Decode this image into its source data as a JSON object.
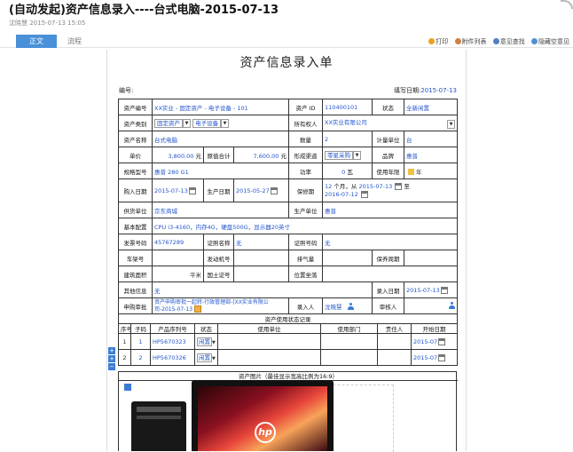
{
  "header": {
    "title": "(自动发起)资产信息录入----台式电脑-2015-07-13",
    "meta": "沈晓慧 2015-07-13 15:05"
  },
  "tabs": [
    {
      "label": "正文",
      "active": true
    },
    {
      "label": "流程",
      "active": false
    }
  ],
  "toolbar": {
    "print": "打印",
    "attachments": "附件列表",
    "find_opinion": "意见查找",
    "hide_opinion": "隐藏空意见"
  },
  "doc": {
    "title": "资产信息录入单",
    "number_label": "编号:",
    "number_value": "",
    "fill_date_label": "填写日期:",
    "fill_date_value": "2015-07-13"
  },
  "form": {
    "asset_code_label": "资产编号",
    "asset_code": "XX实业 - 固定资产 - 电子设备 - 101",
    "asset_id_label": "资产 ID",
    "asset_id": "110400101",
    "status_label": "状态",
    "status": "全新闲置",
    "category_label": "资产类别",
    "category_1": "固定资产",
    "category_2": "电子设备",
    "owner_label": "所有权人",
    "owner": "XX实业有限公司",
    "name_label": "资产名称",
    "name": "台式电脑",
    "qty_label": "数量",
    "qty": "2",
    "unit_label": "计量单位",
    "unit": "台",
    "price_label": "单价",
    "price": "3,800.00",
    "price_unit": "元",
    "total_label": "原值合计",
    "total": "7,600.00",
    "total_unit": "元",
    "channel_label": "形成渠道",
    "channel": "零星采购",
    "brand_label": "品牌",
    "brand": "惠普",
    "model_label": "规格型号",
    "model": "惠普 280 G1",
    "power_label": "功率",
    "power": "0",
    "power_unit": "瓦",
    "life_label": "使用年限",
    "life_unit": "年",
    "buy_date_label": "购入日期",
    "buy_date": "2015-07-13",
    "prod_date_label": "生产日期",
    "prod_date": "2015-05-27",
    "warranty_label": "保修期",
    "warranty_months": "12",
    "warranty_mid": "个月，从",
    "warranty_from": "2015-07-13",
    "warranty_to_label": "至",
    "warranty_to": "2016-07-12",
    "supplier_label": "供货单位",
    "supplier": "京东商城",
    "maker_label": "生产单位",
    "maker": "惠普",
    "config_label": "基本配置",
    "config": "CPU i3-4160，内存4G，硬盘500G，显示器20英寸",
    "invoice_label": "发票号码",
    "invoice": "45767289",
    "cert_name_label": "证照名称",
    "cert_name": "无",
    "cert_no_label": "证照号码",
    "cert_no": "无",
    "plate_label": "车架号",
    "engine_label": "发动机号",
    "displacement_label": "排气量",
    "insurance_label": "保养周期",
    "area_label": "建筑面积",
    "area_unit": "平米",
    "land_label": "国土证号",
    "location_label": "位置坐落",
    "other_label": "其他信息",
    "other": "无",
    "entry_date_label": "录入日期",
    "entry_date": "2015-07-13",
    "approval_label": "申购审批",
    "approval": "资产申购审批一起转-行政管理部-[XX实业有限公司-2015-07-13",
    "entry_person_label": "录入人",
    "entry_person": "沈晓慧",
    "reviewer_label": "审核人"
  },
  "usage": {
    "caption": "资产使用状态记录",
    "headers": [
      "序号",
      "子码",
      "产品序列号",
      "状态",
      "使用单位",
      "使用部门",
      "责任人",
      "开始日期"
    ],
    "rows": [
      {
        "seq": "1",
        "code": "1",
        "serial": "HP5670323",
        "status": "闲置",
        "unit": "",
        "dept": "",
        "person": "",
        "start": "2015-07"
      },
      {
        "seq": "2",
        "code": "2",
        "serial": "HP5670326",
        "status": "闲置",
        "unit": "",
        "dept": "",
        "person": "",
        "start": "2015-07"
      }
    ]
  },
  "picture": {
    "caption": "资产图片（最佳显示宽高比例为16:9）",
    "logo_text": "hp"
  }
}
